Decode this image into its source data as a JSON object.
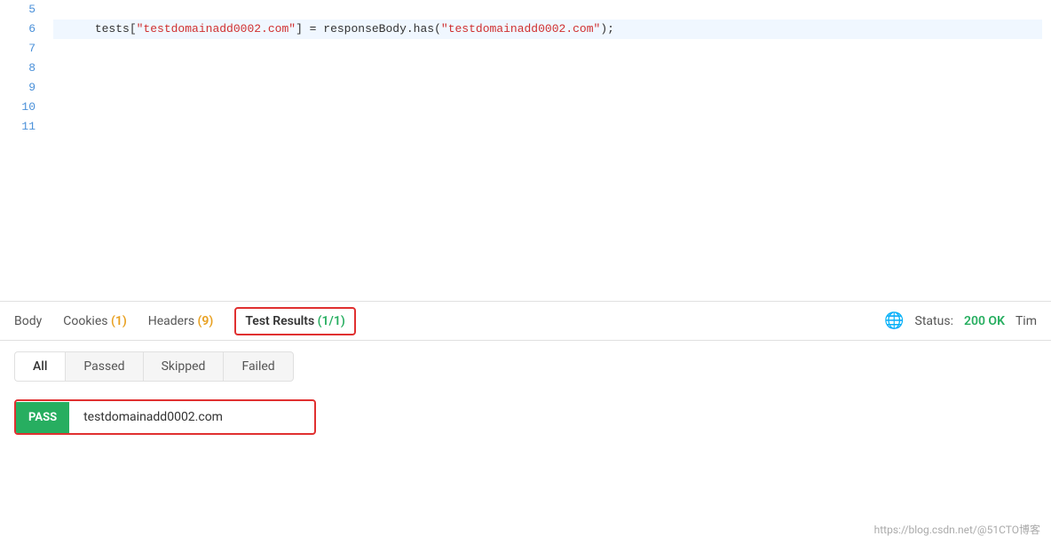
{
  "code": {
    "lines": [
      {
        "num": 5,
        "content": "tests[\"testdomainadd0002.com\"] = responseBody.has(\"testdomainadd0002.com\");",
        "highlighted": false
      },
      {
        "num": 6,
        "content": "",
        "highlighted": true
      },
      {
        "num": 7,
        "content": "",
        "highlighted": false
      },
      {
        "num": 8,
        "content": "",
        "highlighted": false
      },
      {
        "num": 9,
        "content": "",
        "highlighted": false
      },
      {
        "num": 10,
        "content": "",
        "highlighted": false
      },
      {
        "num": 11,
        "content": "",
        "highlighted": false
      }
    ]
  },
  "tabs": {
    "body": "Body",
    "cookies": "Cookies",
    "cookies_count": "(1)",
    "headers": "Headers",
    "headers_count": "(9)",
    "test_results": "Test Results",
    "test_results_count": "(1/1)"
  },
  "status": {
    "label": "Status:",
    "value": "200 OK",
    "time_label": "Tim"
  },
  "filter_tabs": [
    "All",
    "Passed",
    "Skipped",
    "Failed"
  ],
  "test_result": {
    "badge": "PASS",
    "name": "testdomainadd0002.com"
  },
  "watermark": "https://blog.csdn.net/@51CTO博客"
}
